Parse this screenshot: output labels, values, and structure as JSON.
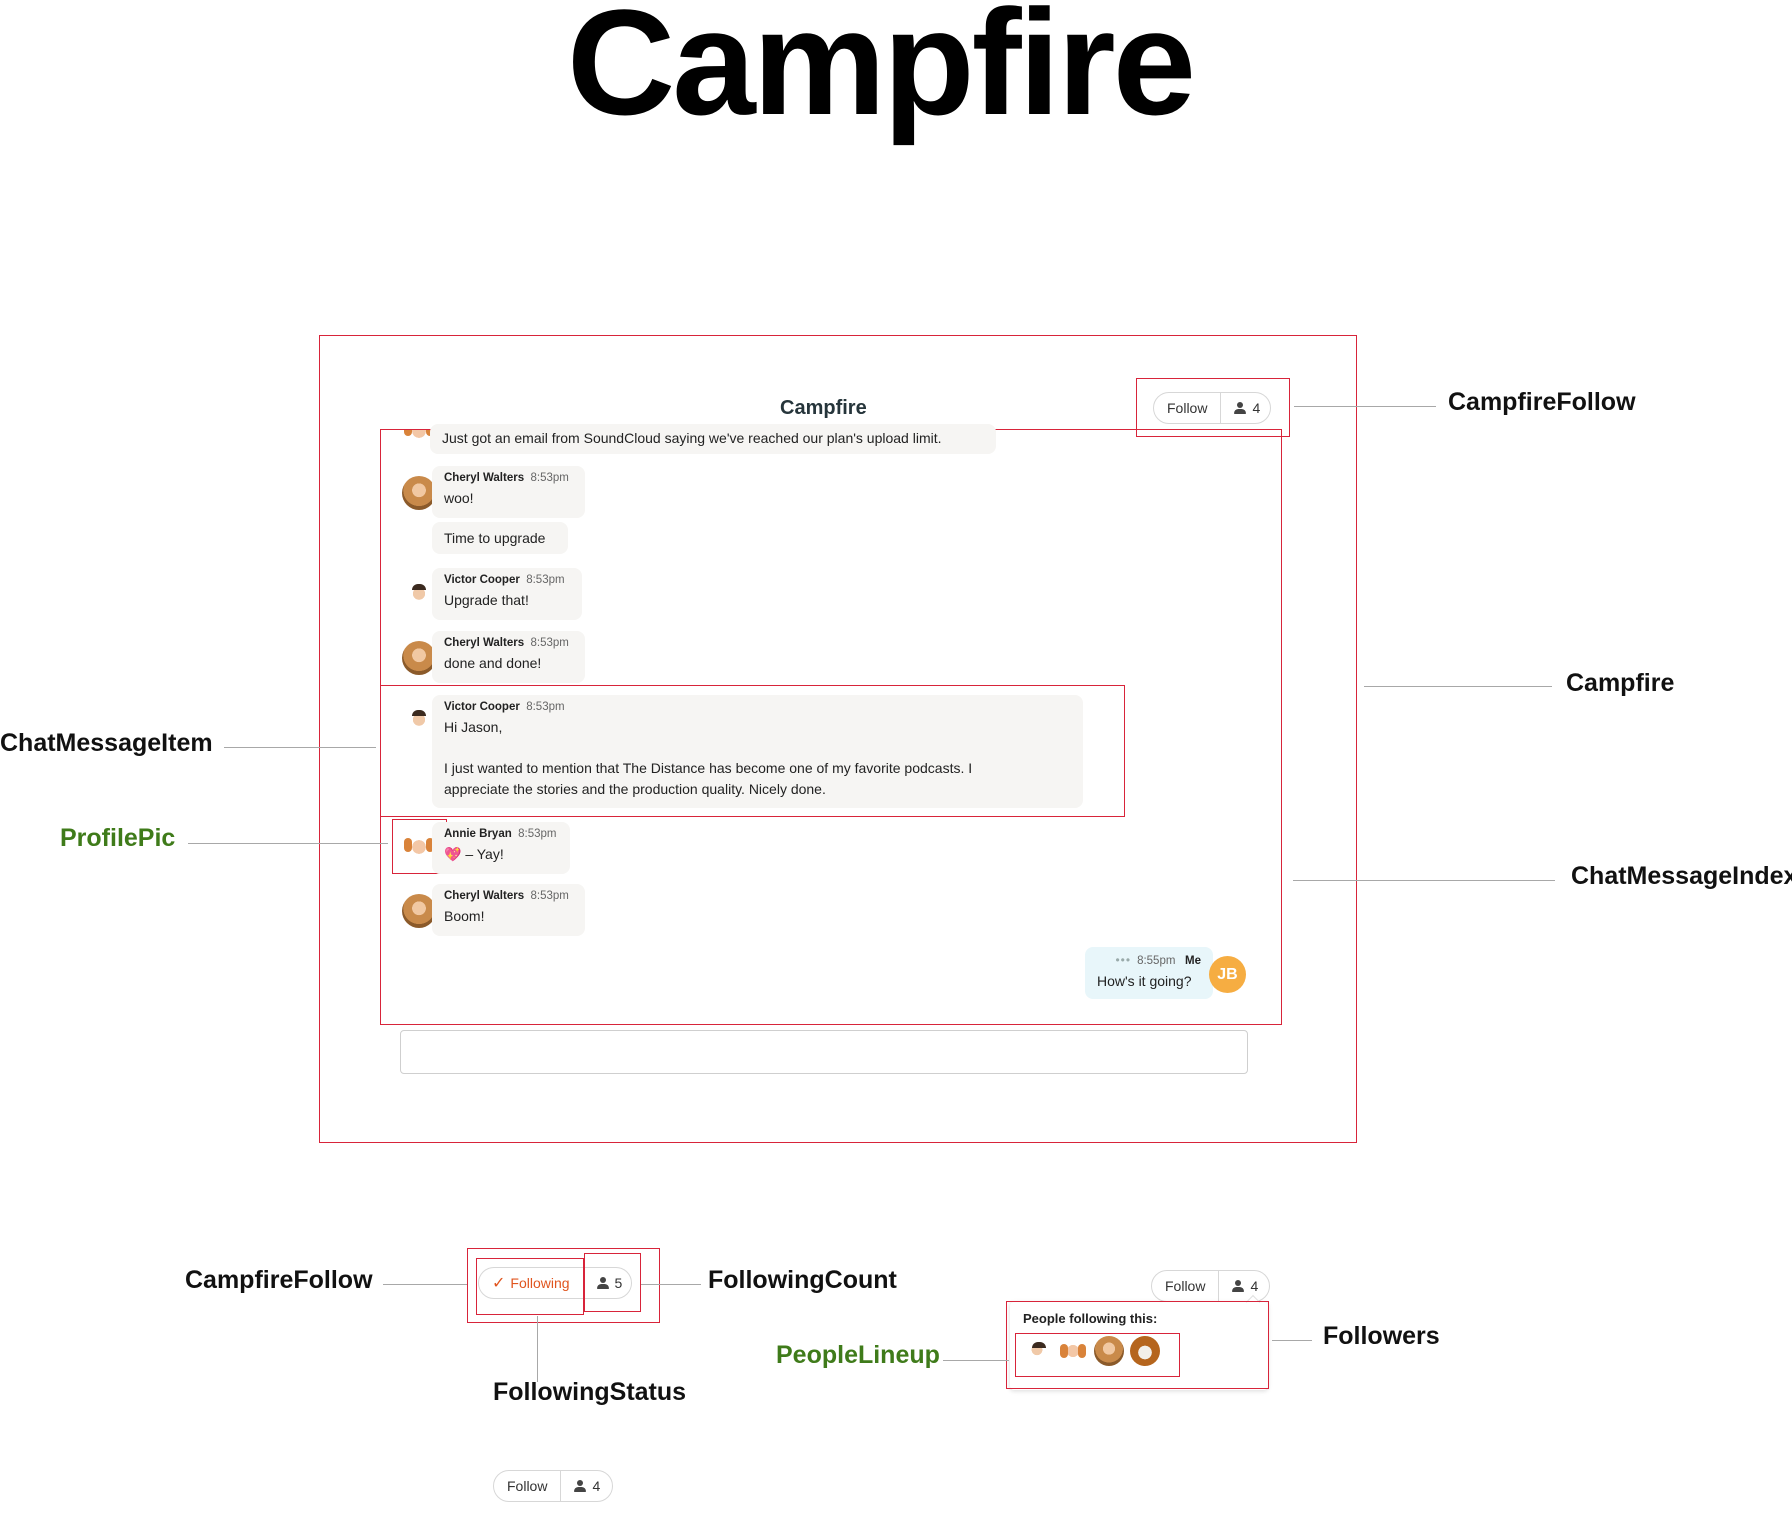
{
  "page_title": "Campfire",
  "app": {
    "title": "Campfire",
    "follow_label": "Follow",
    "follower_count": "4"
  },
  "messages": [
    {
      "body": "Just got an email from SoundCloud saying we've reached our plan's upload limit."
    },
    {
      "author": "Cheryl Walters",
      "time": "8:53pm",
      "body": "woo!",
      "avatar": "cheryl-avatar"
    },
    {
      "body": "Time to upgrade"
    },
    {
      "author": "Victor Cooper",
      "time": "8:53pm",
      "body": "Upgrade that!",
      "avatar": "victor-avatar"
    },
    {
      "author": "Cheryl Walters",
      "time": "8:53pm",
      "body": "done and done!",
      "avatar": "cheryl-avatar"
    },
    {
      "author": "Victor Cooper",
      "time": "8:53pm",
      "body_lines": [
        "Hi Jason,",
        "I just wanted to mention that The Distance has become one of my favorite podcasts. I",
        "appreciate the stories and the production quality. Nicely done."
      ],
      "avatar": "victor-avatar"
    },
    {
      "author": "Annie Bryan",
      "time": "8:53pm",
      "body": "– Yay!",
      "emoji": "heart-icon",
      "avatar": "annie-avatar"
    },
    {
      "author": "Cheryl Walters",
      "time": "8:53pm",
      "body": "Boom!",
      "avatar": "cheryl-avatar"
    },
    {
      "author": "Me",
      "time": "8:55pm",
      "body": "How's it going?",
      "initials": "JB",
      "avatar": "jb-avatar"
    }
  ],
  "callouts": {
    "campfire_follow": "CampfireFollow",
    "campfire": "Campfire",
    "chat_message_item": "ChatMessageItem",
    "profile_pic": "ProfilePic",
    "chat_message_index": "ChatMessageIndex",
    "campfire_follow_2": "CampfireFollow",
    "following_count": "FollowingCount",
    "following_status": "FollowingStatus",
    "people_lineup": "PeopleLineup",
    "followers": "Followers"
  },
  "following_widget": {
    "status_label": "Following",
    "count": "5"
  },
  "followers_widget": {
    "follow_label": "Follow",
    "count": "4",
    "panel_header": "People following this:"
  },
  "bottom_widget": {
    "follow_label": "Follow",
    "count": "4"
  },
  "colors": {
    "annotation_box": "#d8243a",
    "following_accent": "#e0551f",
    "me_avatar": "#f6ad42",
    "callout_green": "#3f7b1a"
  }
}
